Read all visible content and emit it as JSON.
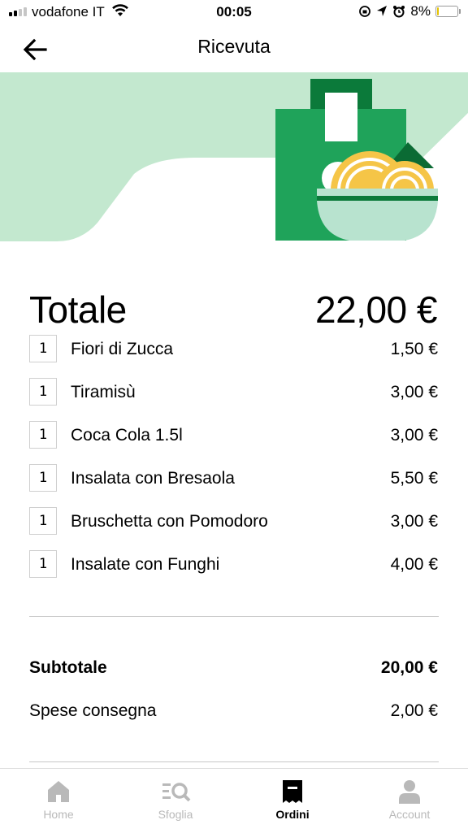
{
  "status_bar": {
    "carrier": "vodafone IT",
    "time": "00:05",
    "battery": "8%",
    "battery_level": 0.08,
    "icons": [
      "signal-icon",
      "wifi-icon",
      "orientation-lock-icon",
      "location-icon",
      "alarm-icon",
      "battery-icon"
    ]
  },
  "header": {
    "title": "Ricevuta",
    "back_icon": "arrow-left-icon"
  },
  "banner": {
    "illustration": "shopping-bag-with-pasta-bowl",
    "colors": {
      "background": "#c3e8cf",
      "bag": "#1fa35a",
      "bag_dark": "#0b7a3a",
      "bowl": "#b8e3cf",
      "noodles": "#f5c547"
    }
  },
  "receipt": {
    "total_label": "Totale",
    "total_value": "22,00 €",
    "items": [
      {
        "qty": "1",
        "name": "Fiori di Zucca",
        "price": "1,50 €"
      },
      {
        "qty": "1",
        "name": "Tiramisù",
        "price": "3,00 €"
      },
      {
        "qty": "1",
        "name": "Coca Cola 1.5l",
        "price": "3,00 €"
      },
      {
        "qty": "1",
        "name": "Insalata con Bresaola",
        "price": "5,50 €"
      },
      {
        "qty": "1",
        "name": "Bruschetta con Pomodoro",
        "price": "3,00 €"
      },
      {
        "qty": "1",
        "name": "Insalate con Funghi",
        "price": "4,00 €"
      }
    ],
    "subtotal_label": "Subtotale",
    "subtotal_value": "20,00 €",
    "delivery_label": "Spese consegna",
    "delivery_value": "2,00 €"
  },
  "tabbar": {
    "tabs": [
      {
        "label": "Home",
        "icon": "home-icon",
        "active": false
      },
      {
        "label": "Sfoglia",
        "icon": "browse-search-icon",
        "active": false
      },
      {
        "label": "Ordini",
        "icon": "receipt-icon",
        "active": true
      },
      {
        "label": "Account",
        "icon": "person-icon",
        "active": false
      }
    ],
    "active_color": "#000000",
    "inactive_color": "#b9b9b9"
  }
}
